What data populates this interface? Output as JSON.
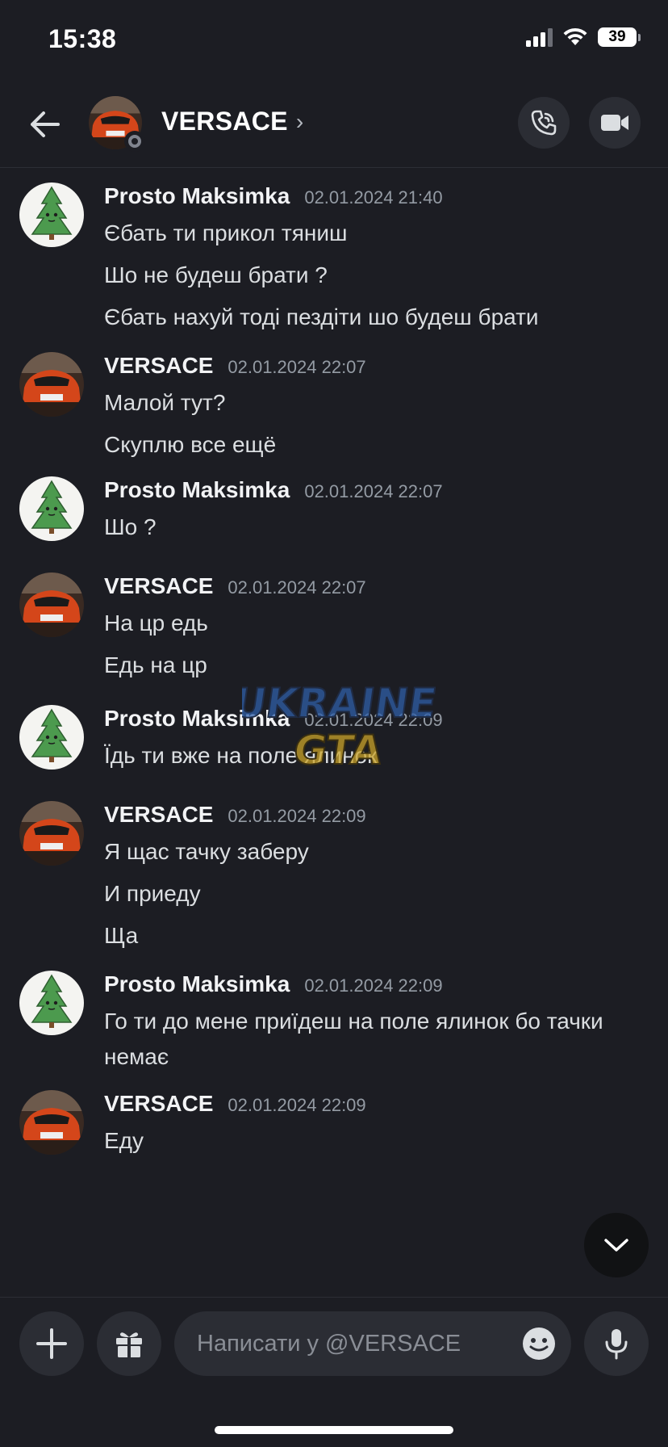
{
  "status_bar": {
    "time": "15:38",
    "battery": "39",
    "icons": [
      "signal-icon",
      "wifi-icon",
      "battery-icon"
    ]
  },
  "header": {
    "title": "VERSACE",
    "chevron": "›",
    "icons": [
      "back-arrow-icon",
      "phone-icon",
      "video-camera-icon"
    ]
  },
  "messages": [
    {
      "author": "Prosto Maksimka",
      "time": "02.01.2024 21:40",
      "avatar": "tree-avatar",
      "lines": [
        "Єбать ти прикол тяниш",
        "Шо не будеш брати ?",
        "Єбать нахуй тоді пездіти шо будеш брати"
      ]
    },
    {
      "author": "VERSACE",
      "time": "02.01.2024 22:07",
      "avatar": "car-avatar",
      "lines": [
        "Малой тут?",
        "Скуплю все ещё"
      ]
    },
    {
      "author": "Prosto Maksimka",
      "time": "02.01.2024 22:07",
      "avatar": "tree-avatar",
      "lines": [
        "Шо ?"
      ]
    },
    {
      "author": "VERSACE",
      "time": "02.01.2024 22:07",
      "avatar": "car-avatar",
      "lines": [
        "На цр едь",
        "Едь на цр"
      ]
    },
    {
      "author": "Prosto Maksimka",
      "time": "02.01.2024 22:09",
      "avatar": "tree-avatar",
      "lines": [
        "Їдь ти вже на поле ялинок"
      ]
    },
    {
      "author": "VERSACE",
      "time": "02.01.2024 22:09",
      "avatar": "car-avatar",
      "lines": [
        "Я щас тачку заберу",
        "И приеду",
        "Ща"
      ]
    },
    {
      "author": "Prosto Maksimka",
      "time": "02.01.2024 22:09",
      "avatar": "tree-avatar",
      "lines": [
        "Го ти до мене приїдеш на поле ялинок бо тачки немає"
      ]
    },
    {
      "author": "VERSACE",
      "time": "02.01.2024 22:09",
      "avatar": "car-avatar",
      "lines": [
        "Еду"
      ]
    }
  ],
  "watermark": {
    "line1": "UKRAINE",
    "line2": "GTA"
  },
  "composer": {
    "placeholder": "Написати у @VERSACE",
    "icons": [
      "plus-icon",
      "gift-icon",
      "emoji-icon",
      "microphone-icon"
    ]
  },
  "colors": {
    "background": "#1c1d23",
    "button_bg": "#2b2d34",
    "text_primary": "#f2f3f5",
    "text_muted": "#949ba4"
  }
}
